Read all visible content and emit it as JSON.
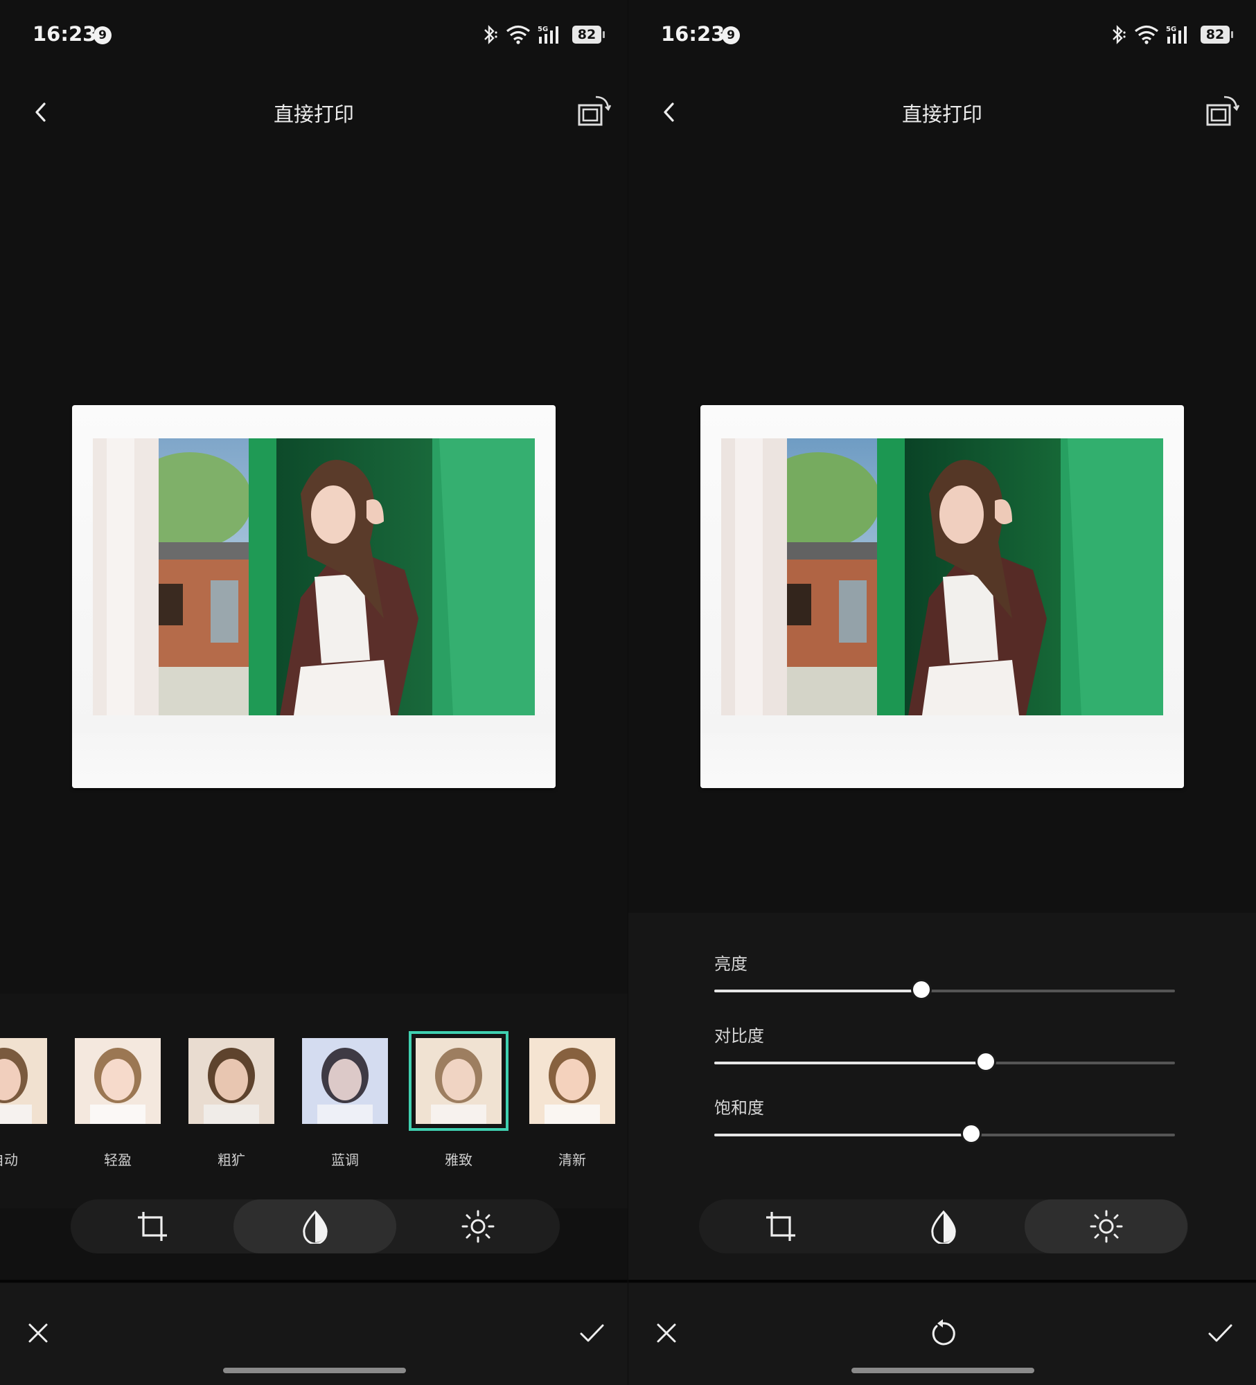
{
  "status_bar": {
    "time": "16:23",
    "notification_count": "9",
    "network": "5G",
    "battery": "82"
  },
  "header": {
    "title": "直接打印"
  },
  "filters": [
    {
      "label": "自动",
      "tint": "#f1e1d0"
    },
    {
      "label": "轻盈",
      "tint": "#f4e8de"
    },
    {
      "label": "粗犷",
      "tint": "#e9dcd0"
    },
    {
      "label": "蓝调",
      "tint": "#d4dcf0"
    },
    {
      "label": "雅致",
      "tint": "#f0e2d2",
      "selected": true
    },
    {
      "label": "清新",
      "tint": "#f5e4d2"
    }
  ],
  "adjustments": [
    {
      "label": "亮度",
      "value": 0.45
    },
    {
      "label": "对比度",
      "value": 0.59
    },
    {
      "label": "饱和度",
      "value": 0.558
    }
  ],
  "colors": {
    "accent": "#3fd0b0",
    "background": "#111111"
  },
  "tools": [
    "crop-icon",
    "filter-icon",
    "brightness-icon"
  ]
}
